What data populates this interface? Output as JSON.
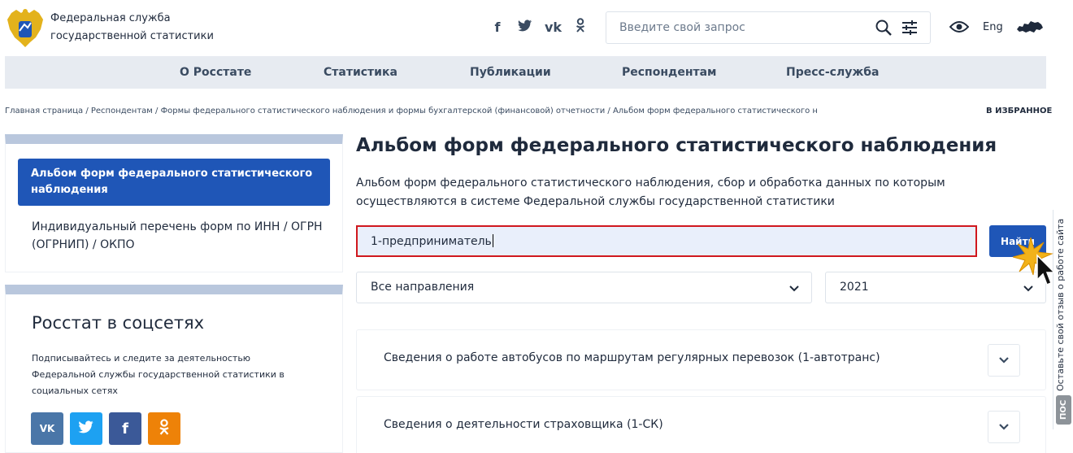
{
  "header": {
    "org_name": "Федеральная служба государственной статистики",
    "social_icons": [
      "facebook-icon",
      "twitter-icon",
      "vk-icon",
      "odnoklassniki-icon"
    ],
    "search_placeholder": "Введите свой запрос",
    "lang": "Eng"
  },
  "nav": {
    "items": [
      {
        "label": "О Росстате"
      },
      {
        "label": "Статистика"
      },
      {
        "label": "Публикации"
      },
      {
        "label": "Респондентам"
      },
      {
        "label": "Пресс-служба"
      }
    ]
  },
  "breadcrumb": {
    "text": "Главная страница / Респондентам / Формы федерального статистического наблюдения и формы бухгалтерской (финансовой) отчетности / Альбом форм федерального статистического наблюдения",
    "favorite": "В ИЗБРАННОЕ"
  },
  "sidebar": {
    "active_item": "Альбом форм федерального статистического наблюдения",
    "item": "Индивидуальный перечень форм по ИНН / ОГРН (ОГРНИП) / ОКПО",
    "social_title": "Росстат в соцсетях",
    "social_text": "Подписывайтесь и следите за деятельностью Федеральной службы государственной статистики в социальных сетях",
    "social_buttons": [
      {
        "label": "VK",
        "color": "#4a76a8"
      },
      {
        "label": "t",
        "color": "#1da1f2"
      },
      {
        "label": "f",
        "color": "#3b5998"
      },
      {
        "label": "ok",
        "color": "#ee8208"
      }
    ]
  },
  "main": {
    "title": "Альбом форм федерального статистического наблюдения",
    "description": "Альбом форм федерального статистического наблюдения, сбор и обработка данных по которым осуществляются в системе Федеральной службы государственной статистики",
    "search_value": "1-предприниматель",
    "find_button": "Найти",
    "direction_select": "Все направления",
    "year_select": "2021",
    "forms": [
      {
        "label": "Сведения о работе автобусов по маршрутам регулярных перевозок (1-автотранс)"
      },
      {
        "label": "Сведения о деятельности страховщика (1-СК)"
      }
    ]
  },
  "feedback": {
    "text": "Оставьте свой отзыв о работе сайта",
    "badge": "ПОС"
  },
  "colors": {
    "accent": "#1f56b7",
    "nav_bg": "#e7ebf1",
    "highlight_border": "#d0181e"
  }
}
